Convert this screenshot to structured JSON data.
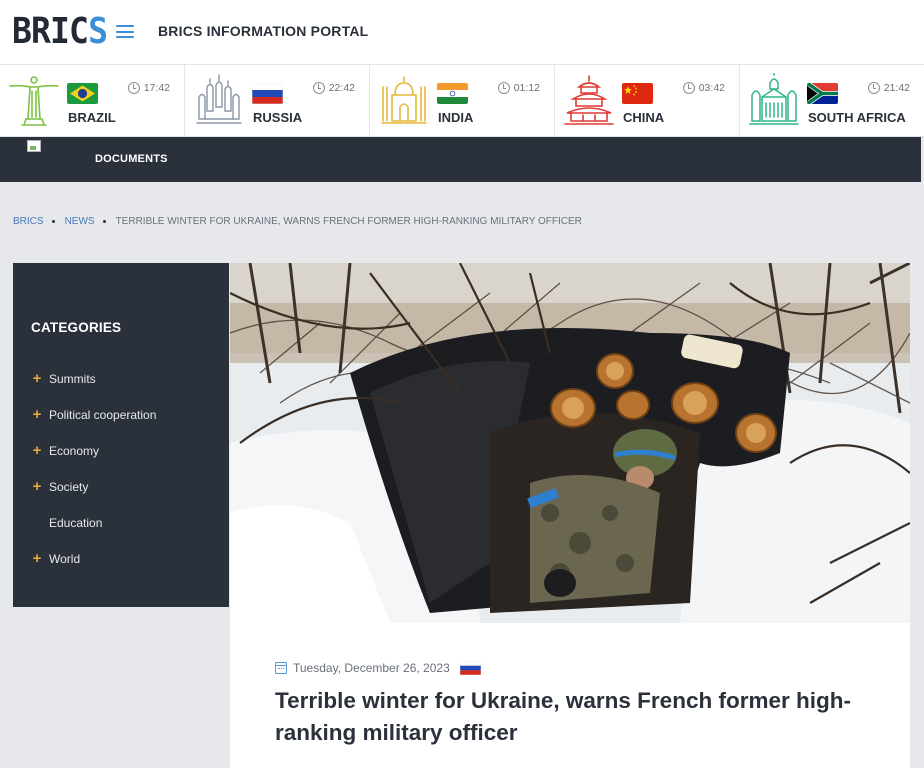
{
  "header": {
    "logo_main": "BRIC",
    "logo_accent": "S",
    "portal_title": "BRICS INFORMATION PORTAL"
  },
  "countries": [
    {
      "name": "BRAZIL",
      "time": "17:42",
      "landmark_icon": "christ-redeemer-icon",
      "flag_icon": "brazil-flag-icon"
    },
    {
      "name": "RUSSIA",
      "time": "22:42",
      "landmark_icon": "kremlin-cathedral-icon",
      "flag_icon": "russia-flag-icon"
    },
    {
      "name": "INDIA",
      "time": "01:12",
      "landmark_icon": "taj-mahal-icon",
      "flag_icon": "india-flag-icon"
    },
    {
      "name": "CHINA",
      "time": "03:42",
      "landmark_icon": "temple-of-heaven-icon",
      "flag_icon": "china-flag-icon"
    },
    {
      "name": "SOUTH AFRICA",
      "time": "21:42",
      "landmark_icon": "union-buildings-icon",
      "flag_icon": "south-africa-flag-icon"
    }
  ],
  "nav": {
    "documents_label": "DOCUMENTS"
  },
  "breadcrumb": {
    "home": "BRICS",
    "section": "NEWS",
    "current": "TERRIBLE WINTER FOR UKRAINE, WARNS FRENCH FORMER HIGH-RANKING MILITARY OFFICER"
  },
  "sidebar": {
    "title": "CATEGORIES",
    "items": [
      {
        "label": "Summits",
        "expandable": true
      },
      {
        "label": "Political cooperation",
        "expandable": true
      },
      {
        "label": "Economy",
        "expandable": true
      },
      {
        "label": "Society",
        "expandable": true
      },
      {
        "label": "Education",
        "expandable": false
      },
      {
        "label": "World",
        "expandable": true
      }
    ]
  },
  "article": {
    "date": "Tuesday, December 26, 2023",
    "source_flag": "russia-flag-icon",
    "title": "Terrible winter for Ukraine, warns French former high-ranking military officer"
  },
  "colors": {
    "accent_blue": "#3b8fd6",
    "dark_nav": "#2b313b",
    "plus_orange": "#e2a93b",
    "landmark_brazil": "#7cc142",
    "landmark_india": "#e6b93c",
    "landmark_china": "#e03a35",
    "landmark_sa": "#2fb48a"
  }
}
